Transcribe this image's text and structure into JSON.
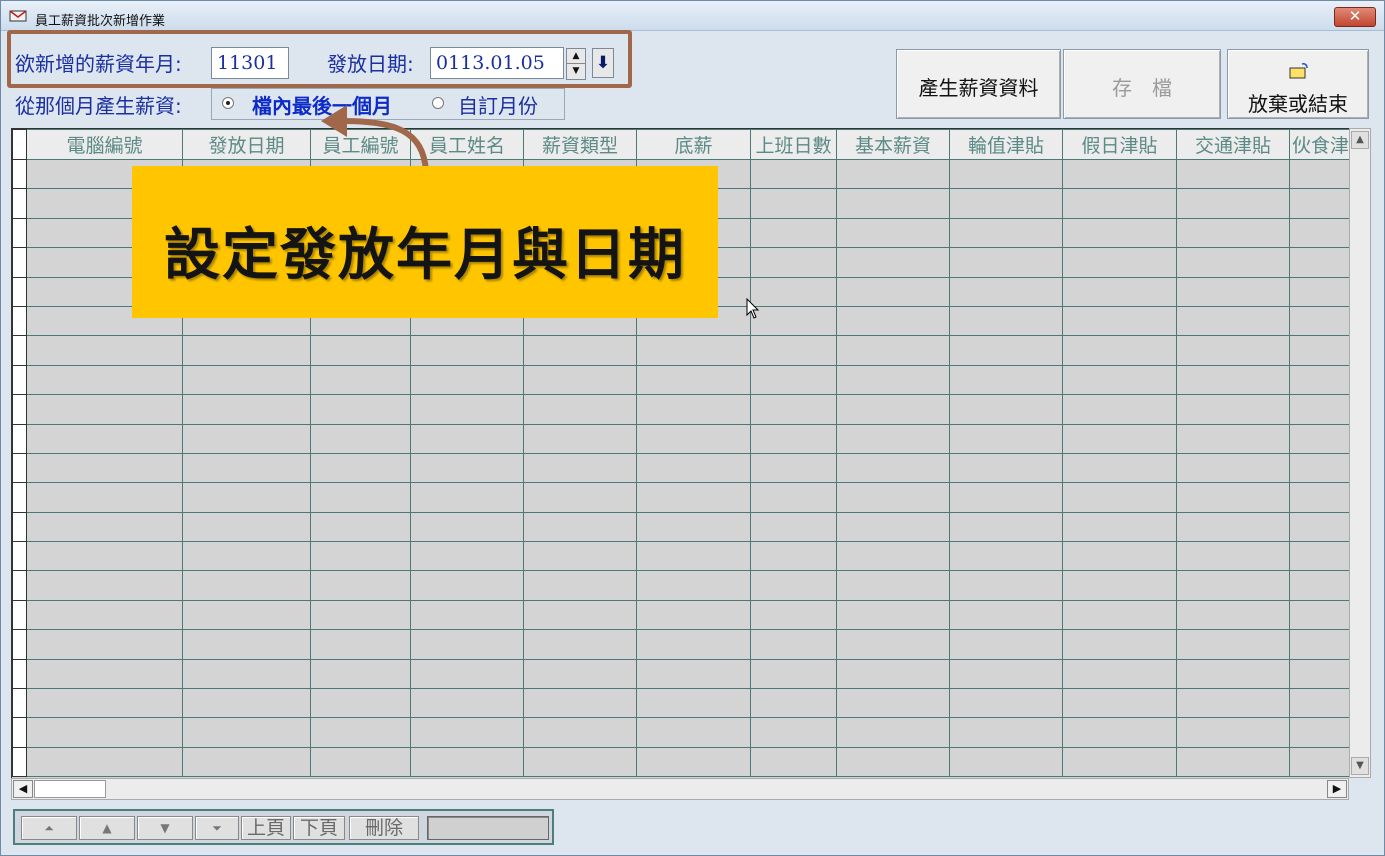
{
  "window": {
    "title": "員工薪資批次新增作業",
    "close_label": "✕"
  },
  "form": {
    "salary_month_label": "欲新增的薪資年月:",
    "salary_month_value": "11301",
    "pay_date_label": "發放日期:",
    "pay_date_value": "0113.01.05",
    "source_label": "從那個月產生薪資:",
    "source_options": [
      {
        "label": "檔內最後一個月",
        "selected": true
      },
      {
        "label": "自訂月份",
        "selected": false
      }
    ]
  },
  "toolbar": {
    "generate_label": "產生薪資資料",
    "save_label": "存　檔",
    "exit_label": "放棄或結束"
  },
  "grid": {
    "columns": [
      "電腦編號",
      "發放日期",
      "員工編號",
      "員工姓名",
      "薪資類型",
      "底薪",
      "上班日數",
      "基本薪資",
      "輪值津貼",
      "假日津貼",
      "交通津貼",
      "伙食津"
    ],
    "row_count": 21
  },
  "navigator": {
    "first_icon": "first-record-icon",
    "prev_icon": "previous-record-icon",
    "next_icon": "next-record-icon",
    "last_icon": "last-record-icon",
    "prev_page_label": "上頁",
    "next_page_label": "下頁",
    "delete_label": "刪除",
    "search_value": ""
  },
  "annotation": {
    "callout_text": "設定發放年月與日期"
  },
  "colors": {
    "label_blue": "#1a2fa0",
    "callout_yellow": "#ffc600",
    "highlight_brown": "#a0674a",
    "grid_line": "#4a7a78"
  }
}
